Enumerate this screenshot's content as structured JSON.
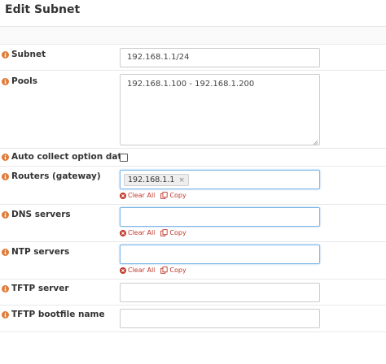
{
  "header": {
    "title": "Edit Subnet"
  },
  "icons": {
    "info": "info-circle-icon",
    "clear": "times-circle-icon",
    "copy": "copy-icon"
  },
  "colors": {
    "info_icon": "#e07b39",
    "action_link": "#c0392b",
    "focus_border": "#7fb6e6"
  },
  "fields": {
    "subnet": {
      "label": "Subnet",
      "value": "192.168.1.1/24"
    },
    "pools": {
      "label": "Pools",
      "value": "192.168.1.100 - 192.168.1.200"
    },
    "auto_collect": {
      "label": "Auto collect option data",
      "checked": false
    },
    "routers": {
      "label": "Routers (gateway)",
      "tags": [
        "192.168.1.1"
      ],
      "tag_remove": "×"
    },
    "dns": {
      "label": "DNS servers",
      "value": ""
    },
    "ntp": {
      "label": "NTP servers",
      "value": ""
    },
    "tftp_server": {
      "label": "TFTP server",
      "value": ""
    },
    "tftp_bootfile": {
      "label": "TFTP bootfile name",
      "value": ""
    }
  },
  "actions": {
    "clear_all": "Clear All",
    "copy": "Copy"
  }
}
